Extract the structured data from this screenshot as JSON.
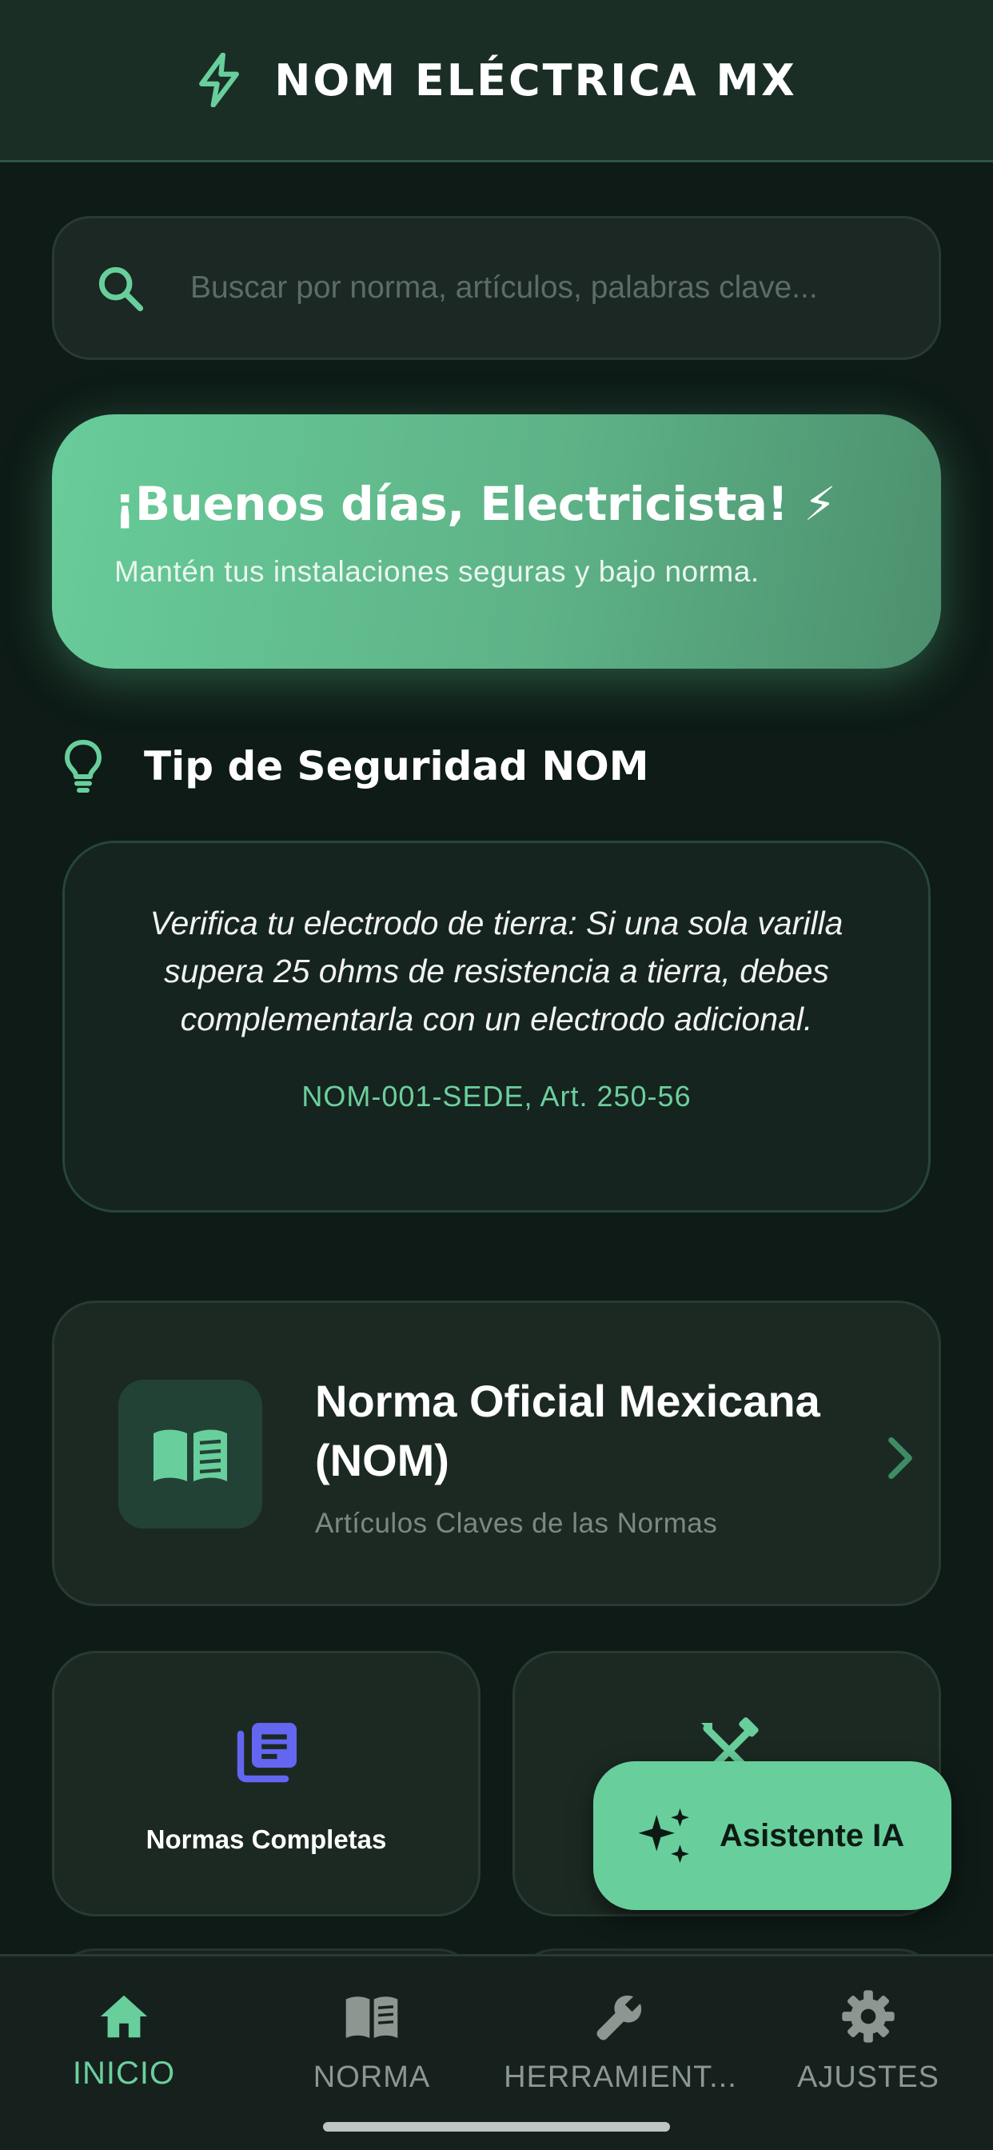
{
  "header": {
    "title": "NOM ELÉCTRICA MX",
    "icon": "bolt-icon",
    "accent": "#68cf9c"
  },
  "search": {
    "placeholder": "Buscar por norma, artículos, palabras clave...",
    "value": ""
  },
  "greeting": {
    "title": "¡Buenos días, Electricista! ⚡",
    "subtitle": "Mantén tus instalaciones seguras y bajo norma."
  },
  "tip": {
    "heading": "Tip de Seguridad NOM",
    "text": "Verifica tu electrodo de tierra: Si una sola varilla supera 25 ohms de resistencia a tierra, debes complementarla con un electrodo adicional.",
    "reference": "NOM-001-SEDE, Art. 250-56"
  },
  "nom_card": {
    "title": "Norma Oficial Mexicana (NOM)",
    "subtitle": "Artículos Claves de las Normas"
  },
  "grid": [
    {
      "label": "Normas Completas",
      "icon": "document-stack-icon",
      "color": "#6366f1"
    },
    {
      "label": "",
      "icon": "tools-icon",
      "color": "#68cf9c"
    }
  ],
  "fab": {
    "label": "Asistente IA",
    "icon": "sparkles-icon"
  },
  "bottom_nav": [
    {
      "label": "INICIO",
      "icon": "home-icon",
      "active": true
    },
    {
      "label": "NORMA",
      "icon": "book-icon",
      "active": false
    },
    {
      "label": "HERRAMIENT...",
      "icon": "wrench-icon",
      "active": false
    },
    {
      "label": "AJUSTES",
      "icon": "gear-icon",
      "active": false
    }
  ]
}
